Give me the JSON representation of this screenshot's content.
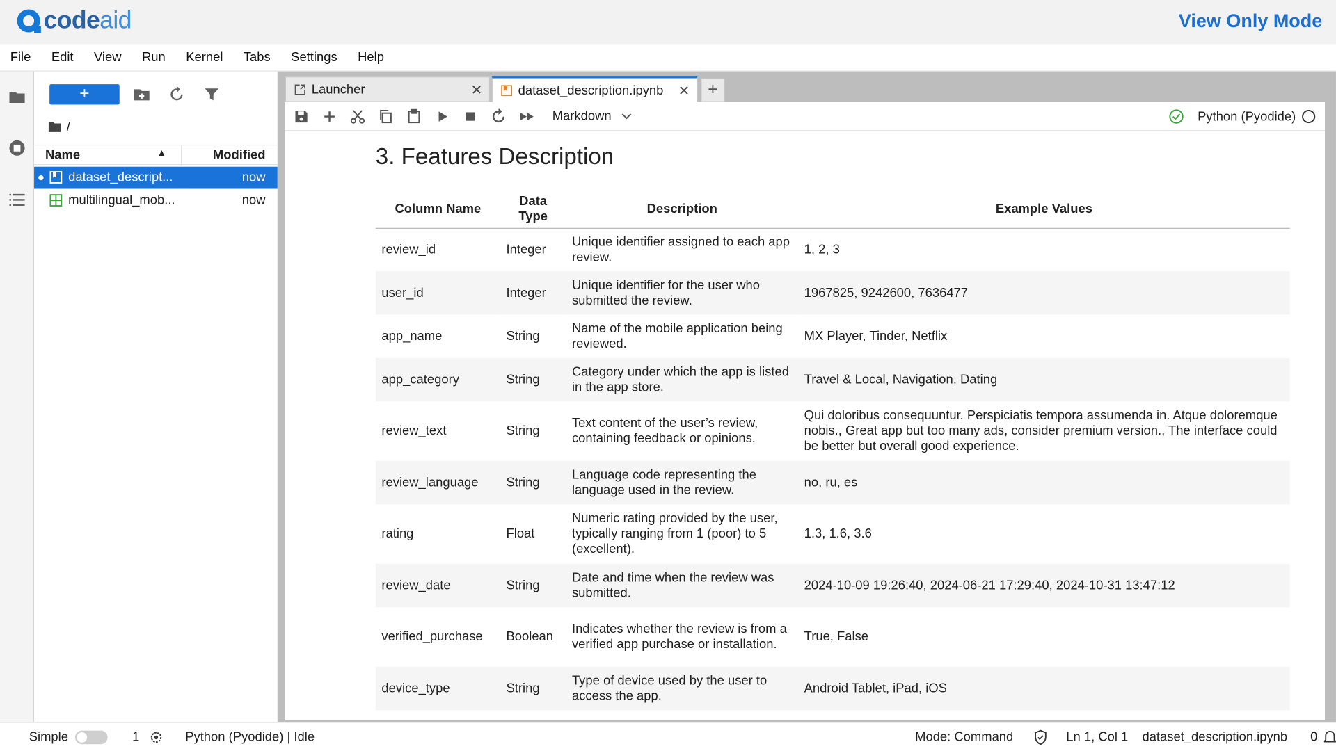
{
  "brand": {
    "code": "code",
    "aid": "aid",
    "mode_label": "View Only Mode"
  },
  "menu": [
    "File",
    "Edit",
    "View",
    "Run",
    "Kernel",
    "Tabs",
    "Settings",
    "Help"
  ],
  "filebrowser": {
    "new_label": "+",
    "path": "/",
    "col_name": "Name",
    "col_modified": "Modified",
    "files": [
      {
        "name": "dataset_descript...",
        "modified": "now"
      },
      {
        "name": "multilingual_mob...",
        "modified": "now"
      }
    ]
  },
  "tabs": [
    {
      "label": "Launcher",
      "close": "✕"
    },
    {
      "label": "dataset_description.ipynb",
      "close": "✕"
    }
  ],
  "tab_add": "+",
  "toolbar": {
    "cell_type": "Markdown",
    "kernel": "Python (Pyodide)"
  },
  "notebook": {
    "heading": "3. Features Description",
    "columns": [
      "Column Name",
      "Data Type",
      "Description",
      "Example Values"
    ],
    "rows": [
      {
        "name": "review_id",
        "type": "Integer",
        "desc": "Unique identifier assigned to each app review.",
        "example": "1, 2, 3"
      },
      {
        "name": "user_id",
        "type": "Integer",
        "desc": "Unique identifier for the user who submitted the review.",
        "example": "1967825, 9242600, 7636477"
      },
      {
        "name": "app_name",
        "type": "String",
        "desc": "Name of the mobile application being reviewed.",
        "example": "MX Player, Tinder, Netflix"
      },
      {
        "name": "app_category",
        "type": "String",
        "desc": "Category under which the app is listed in the app store.",
        "example": "Travel & Local, Navigation, Dating"
      },
      {
        "name": "review_text",
        "type": "String",
        "desc": "Text content of the user’s review, containing feedback or opinions.",
        "example": "Qui doloribus consequuntur. Perspiciatis tempora assumenda in. Atque doloremque nobis., Great app but too many ads, consider premium version., The interface could be better but overall good experience."
      },
      {
        "name": "review_language",
        "type": "String",
        "desc": "Language code representing the language used in the review.",
        "example": "no, ru, es"
      },
      {
        "name": "rating",
        "type": "Float",
        "desc": "Numeric rating provided by the user, typically ranging from 1 (poor) to 5 (excellent).",
        "example": "1.3, 1.6, 3.6"
      },
      {
        "name": "review_date",
        "type": "String",
        "desc": "Date and time when the review was submitted.",
        "example": "2024-10-09 19:26:40, 2024-06-21 17:29:40, 2024-10-31 13:47:12"
      },
      {
        "name": "verified_purchase",
        "type": "Boolean",
        "desc": "Indicates whether the review is from a verified app purchase or installation.",
        "example": "True, False"
      },
      {
        "name": "device_type",
        "type": "String",
        "desc": "Type of device used by the user to access the app.",
        "example": "Android Tablet, iPad, iOS"
      }
    ]
  },
  "statusbar": {
    "simple": "Simple",
    "count": "1",
    "kernel_status": "Python (Pyodide) | Idle",
    "mode": "Mode: Command",
    "position": "Ln 1, Col 1",
    "filename": "dataset_description.ipynb",
    "zero": "0"
  },
  "colors": {
    "accent": "#1a73d9",
    "brand_dark": "#2761a8",
    "brand_light": "#3d8fe3",
    "notebook_icon": "#f0831e",
    "csv_icon": "#3aa63a",
    "kernel_ok": "#3aa63a"
  }
}
